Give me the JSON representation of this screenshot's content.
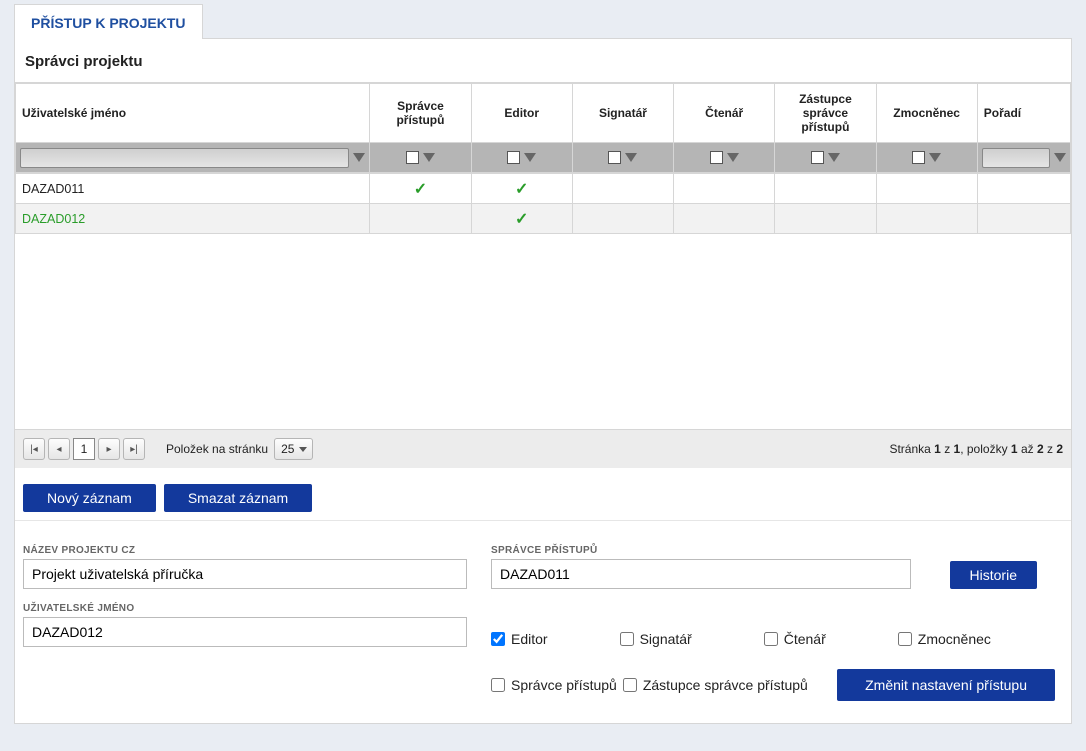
{
  "tab": {
    "title": "PŘÍSTUP K PROJEKTU"
  },
  "section_title": "Správci projektu",
  "grid": {
    "columns": [
      {
        "key": "user",
        "label": "Uživatelské jméno"
      },
      {
        "key": "admin",
        "label": "Správce přístupů"
      },
      {
        "key": "editor",
        "label": "Editor"
      },
      {
        "key": "sign",
        "label": "Signatář"
      },
      {
        "key": "reader",
        "label": "Čtenář"
      },
      {
        "key": "deputy",
        "label": "Zástupce správce přístupů"
      },
      {
        "key": "proxy",
        "label": "Zmocněnec"
      },
      {
        "key": "order",
        "label": "Pořadí"
      }
    ],
    "rows": [
      {
        "user": "DAZAD011",
        "admin": true,
        "editor": true,
        "sign": false,
        "reader": false,
        "deputy": false,
        "proxy": false,
        "order": "",
        "selected": false
      },
      {
        "user": "DAZAD012",
        "admin": false,
        "editor": true,
        "sign": false,
        "reader": false,
        "deputy": false,
        "proxy": false,
        "order": "",
        "selected": true
      }
    ]
  },
  "pager": {
    "items_per_page_label": "Položek na stránku",
    "page_size": "25",
    "current_page": "1",
    "info_prefix": "Stránka ",
    "info_page": "1",
    "info_of": " z ",
    "info_total_pages": "1",
    "info_items_prefix": ", položky ",
    "info_from": "1",
    "info_to_sep": " až ",
    "info_to": "2",
    "info_total_sep": " z ",
    "info_total": "2"
  },
  "buttons": {
    "new": "Nový záznam",
    "delete": "Smazat záznam",
    "history": "Historie",
    "change": "Změnit nastavení přístupu"
  },
  "form": {
    "project_label": "NÁZEV PROJEKTU CZ",
    "project_value": "Projekt uživatelská příručka",
    "admin_label": "SPRÁVCE PŘÍSTUPŮ",
    "admin_value": "DAZAD011",
    "user_label": "UŽIVATELSKÉ JMÉNO",
    "user_value": "DAZAD012",
    "roles": {
      "editor": {
        "label": "Editor",
        "checked": true
      },
      "sign": {
        "label": "Signatář",
        "checked": false
      },
      "reader": {
        "label": "Čtenář",
        "checked": false
      },
      "proxy": {
        "label": "Zmocněnec",
        "checked": false
      }
    },
    "admin_role": {
      "label": "Správce přístupů",
      "checked": false
    },
    "deputy_role": {
      "label": "Zástupce správce přístupů",
      "checked": false
    }
  }
}
